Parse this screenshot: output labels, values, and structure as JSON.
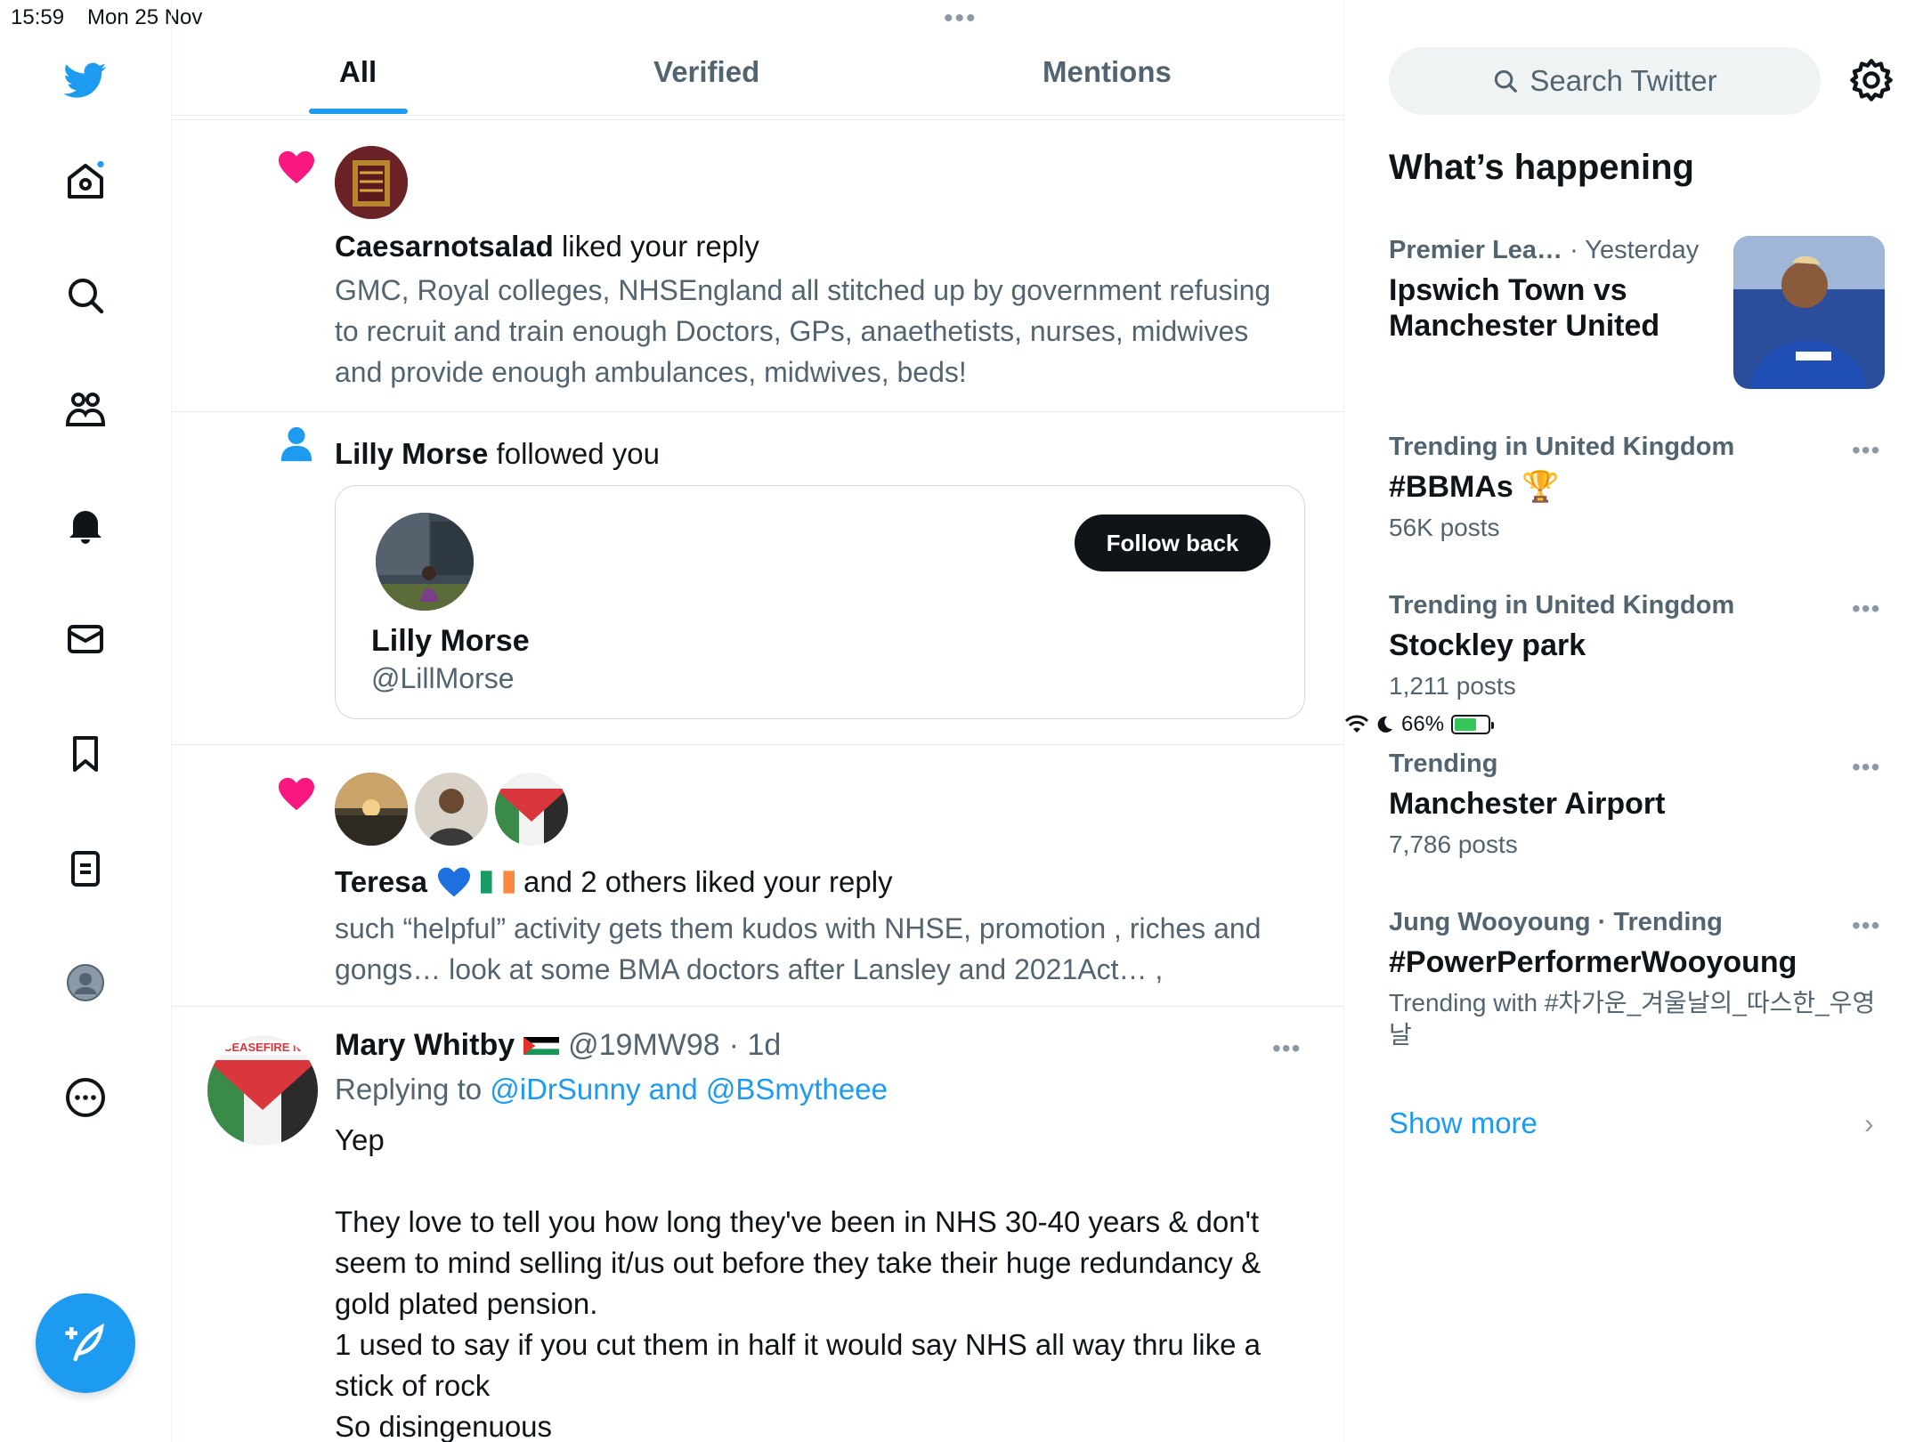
{
  "status_bar": {
    "time": "15:59",
    "date": "Mon 25 Nov",
    "battery": "66%",
    "battery_level": 0.66
  },
  "nav": {
    "icons": [
      "twitter-logo-icon",
      "home-icon",
      "search-icon",
      "communities-icon",
      "notifications-icon",
      "messages-icon",
      "bookmarks-icon",
      "lists-icon",
      "profile-icon",
      "more-icon"
    ],
    "compose_icon": "compose-icon",
    "accent": "#1d9bf0"
  },
  "tabs": [
    {
      "label": "All",
      "active": true
    },
    {
      "label": "Verified",
      "active": false
    },
    {
      "label": "Mentions",
      "active": false
    }
  ],
  "notifications": {
    "like1": {
      "user": "Caesarnotsalad",
      "action": " liked your reply",
      "body": "GMC, Royal colleges, NHSEngland all stitched up by government refusing to recruit and train enough Doctors, GPs, anaethetists, nurses, midwives and provide enough ambulances, midwives, beds!"
    },
    "follow": {
      "user": "Lilly Morse",
      "action": " followed you",
      "card_name": "Lilly Morse",
      "card_handle": "@LillMorse",
      "button": "Follow back"
    },
    "like2": {
      "user": "Teresa",
      "action": "and 2 others liked your reply",
      "body": "such “helpful” activity gets them kudos with NHSE, promotion , riches and gongs… look at some BMA doctors after Lansley and 2021Act… ,"
    }
  },
  "tweet": {
    "name": "Mary Whitby",
    "handle": "@19MW98",
    "time": "· 1d",
    "replying_prefix": "Replying to ",
    "replying_to": "@iDrSunny and @BSmytheee",
    "text": "Yep\n\nThey love to tell you how long they've been in NHS 30-40 years & don't seem to mind selling it/us out before they take their huge redundancy & gold plated pension.\n1 used to say if you cut them in half it would say NHS all way thru like a stick of rock\nSo disingenuous",
    "avatar_text": "CEASEFIRE NOW"
  },
  "sidebar": {
    "search_placeholder": "Search Twitter",
    "heading": "What’s happening",
    "trends": [
      {
        "category": "Premier Lea…",
        "time": " · Yesterday",
        "title": "Ipswich Town vs Manchester United",
        "count": ""
      },
      {
        "category": "Trending in United Kingdom",
        "title": "#BBMAs 🏆",
        "count": "56K posts"
      },
      {
        "category": "Trending in United Kingdom",
        "title": "Stockley park",
        "count": "1,211 posts"
      },
      {
        "category": "Trending",
        "title": "Manchester Airport",
        "count": "7,786 posts"
      },
      {
        "category": "Jung Wooyoung · Trending",
        "title": "#PowerPerformerWooyoung",
        "count": "Trending with #차가운_겨울날의_따스한_우영날"
      }
    ],
    "show_more": "Show more"
  }
}
